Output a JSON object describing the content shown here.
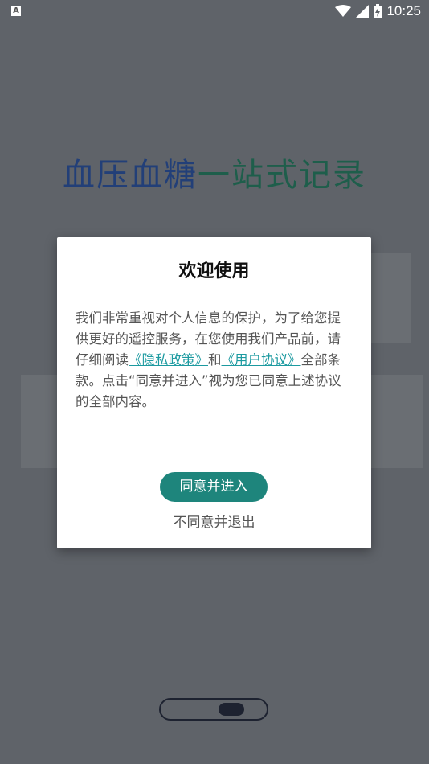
{
  "status_bar": {
    "left_icon_letter": "A",
    "time": "10:25",
    "icons": [
      "wifi-icon",
      "signal-icon",
      "battery-icon"
    ]
  },
  "app": {
    "title_part1": "血压血糖",
    "title_part2": "一站式记录"
  },
  "dialog": {
    "title": "欢迎使用",
    "body_part1": "我们非常重视对个人信息的保护，为了给您提供更好的遥控服务，在您使用我们产品前，请仔细阅读",
    "privacy_link": "《隐私政策》",
    "body_and": "和",
    "agreement_link": "《用户协议》",
    "body_part2": "全部条款。点击“同意并进入”视为您已同意上述协议的全部内容。",
    "agree_label": "同意并进入",
    "reject_label": "不同意并退出"
  },
  "colors": {
    "accent": "#1e857c",
    "link": "#1c9aa0",
    "overlay_bg": "#5f6369",
    "title_blue": "#223f78",
    "title_green": "#1e5e4b"
  }
}
